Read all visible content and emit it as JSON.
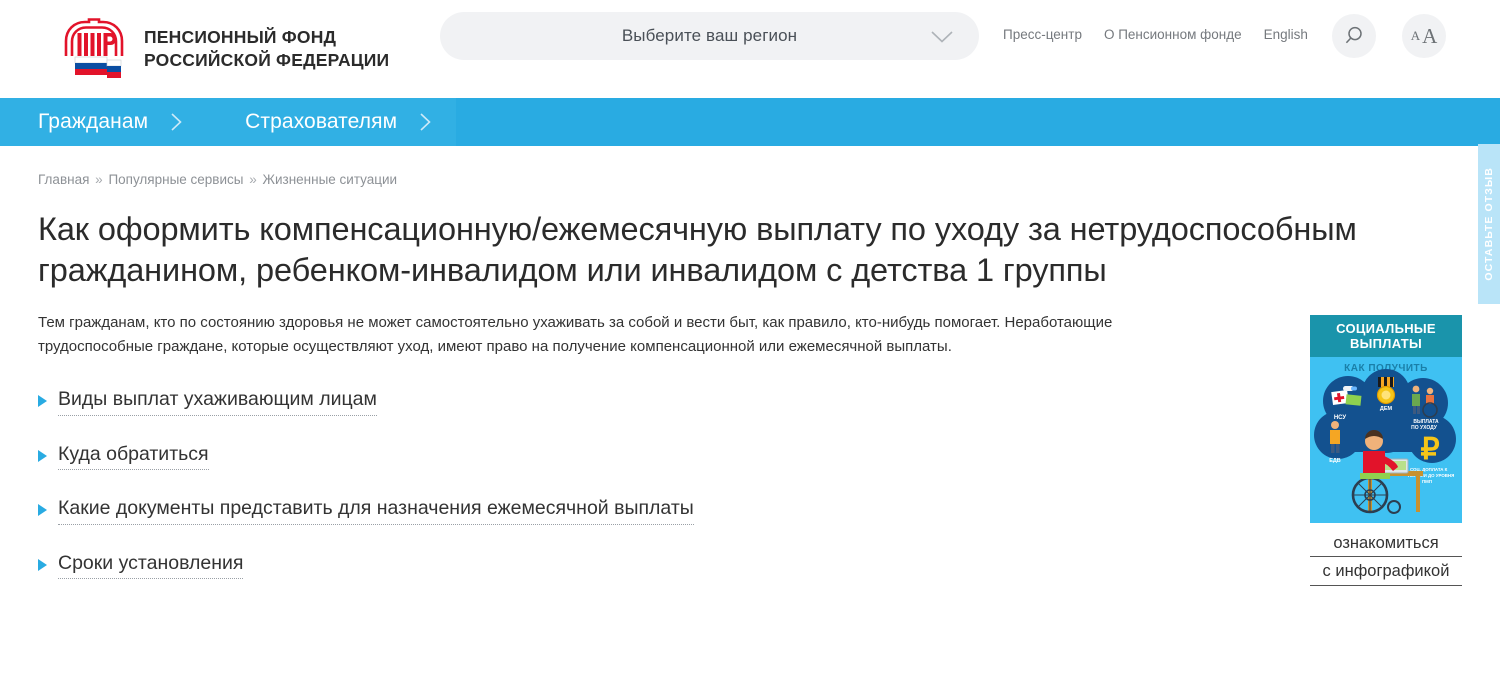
{
  "header": {
    "logo_icon": "pfr-emblem-icon",
    "brand_line1": "ПЕНСИОННЫЙ ФОНД",
    "brand_line2": "РОССИЙСКОЙ ФЕДЕРАЦИИ",
    "region_select": {
      "value": "Выберите ваш регион",
      "chevron_icon": "chevron-down-icon"
    },
    "top_links": [
      {
        "label": "Пресс-центр"
      },
      {
        "label": "О Пенсионном фонде"
      },
      {
        "label": "English"
      }
    ],
    "search_icon": "search-icon",
    "font_size": {
      "small_label": "A",
      "large_label": "A",
      "icon": "font-size-icon"
    }
  },
  "nav": {
    "items": [
      {
        "label": "Гражданам",
        "chevron_icon": "chevron-right-icon"
      },
      {
        "label": "Страхователям",
        "chevron_icon": "chevron-right-icon"
      }
    ]
  },
  "breadcrumb": {
    "items": [
      {
        "label": "Главная"
      },
      {
        "label": "Популярные сервисы"
      },
      {
        "label": "Жизненные ситуации"
      }
    ],
    "separator": "»"
  },
  "page": {
    "title": "Как оформить компенсационную/ежемесячную выплату по уходу за нетрудоспособным гражданином, ребенком-инвалидом или инвалидом с детства 1 группы",
    "lead": "Тем гражданам, кто по состоянию здоровья не может самостоятельно ухаживать за собой и вести быт, как правило, кто-нибудь помогает. Неработающие трудоспособные граждане, которые осуществляют уход, имеют право на получение компенсационной или ежемесячной выплаты.",
    "links": [
      {
        "label": "Виды выплат ухаживающим лицам",
        "bullet_icon": "triangle-right-icon"
      },
      {
        "label": "Куда обратиться",
        "bullet_icon": "triangle-right-icon"
      },
      {
        "label": "Какие документы представить для назначения ежемесячной выплаты",
        "bullet_icon": "triangle-right-icon"
      },
      {
        "label": "Сроки установления",
        "bullet_icon": "triangle-right-icon"
      }
    ]
  },
  "sidebar": {
    "infographic": {
      "title_line1": "СОЦИАЛЬНЫЕ",
      "title_line2": "ВЫПЛАТЫ",
      "subtitle": "КАК ПОЛУЧИТЬ",
      "labels": {
        "nsu": "НСУ",
        "dem": "ДЕМ",
        "care": "ВЫПЛАТА ПО УХОДУ",
        "edv": "ЕДВ",
        "supplement": "СОЦ. ДОПЛАТА К ПЕНСИИ ДО УРОВНЯ ПМП",
        "ruble": "₽"
      },
      "caption_line1": "ознакомиться",
      "caption_line2": "с инфографикой"
    }
  },
  "feedback": {
    "label": "ОСТАВЬТЕ ОТЗЫВ"
  },
  "colors": {
    "nav_blue": "#29abe2",
    "nav_tab_blue": "#31b0e4",
    "accent_blue": "#29abe2",
    "info_teal": "#1a94ab",
    "info_sky": "#3fc1f2",
    "feedback_blue": "#b9e4f8",
    "text_dark": "#2b2b2b",
    "text_muted": "#8d9196"
  }
}
